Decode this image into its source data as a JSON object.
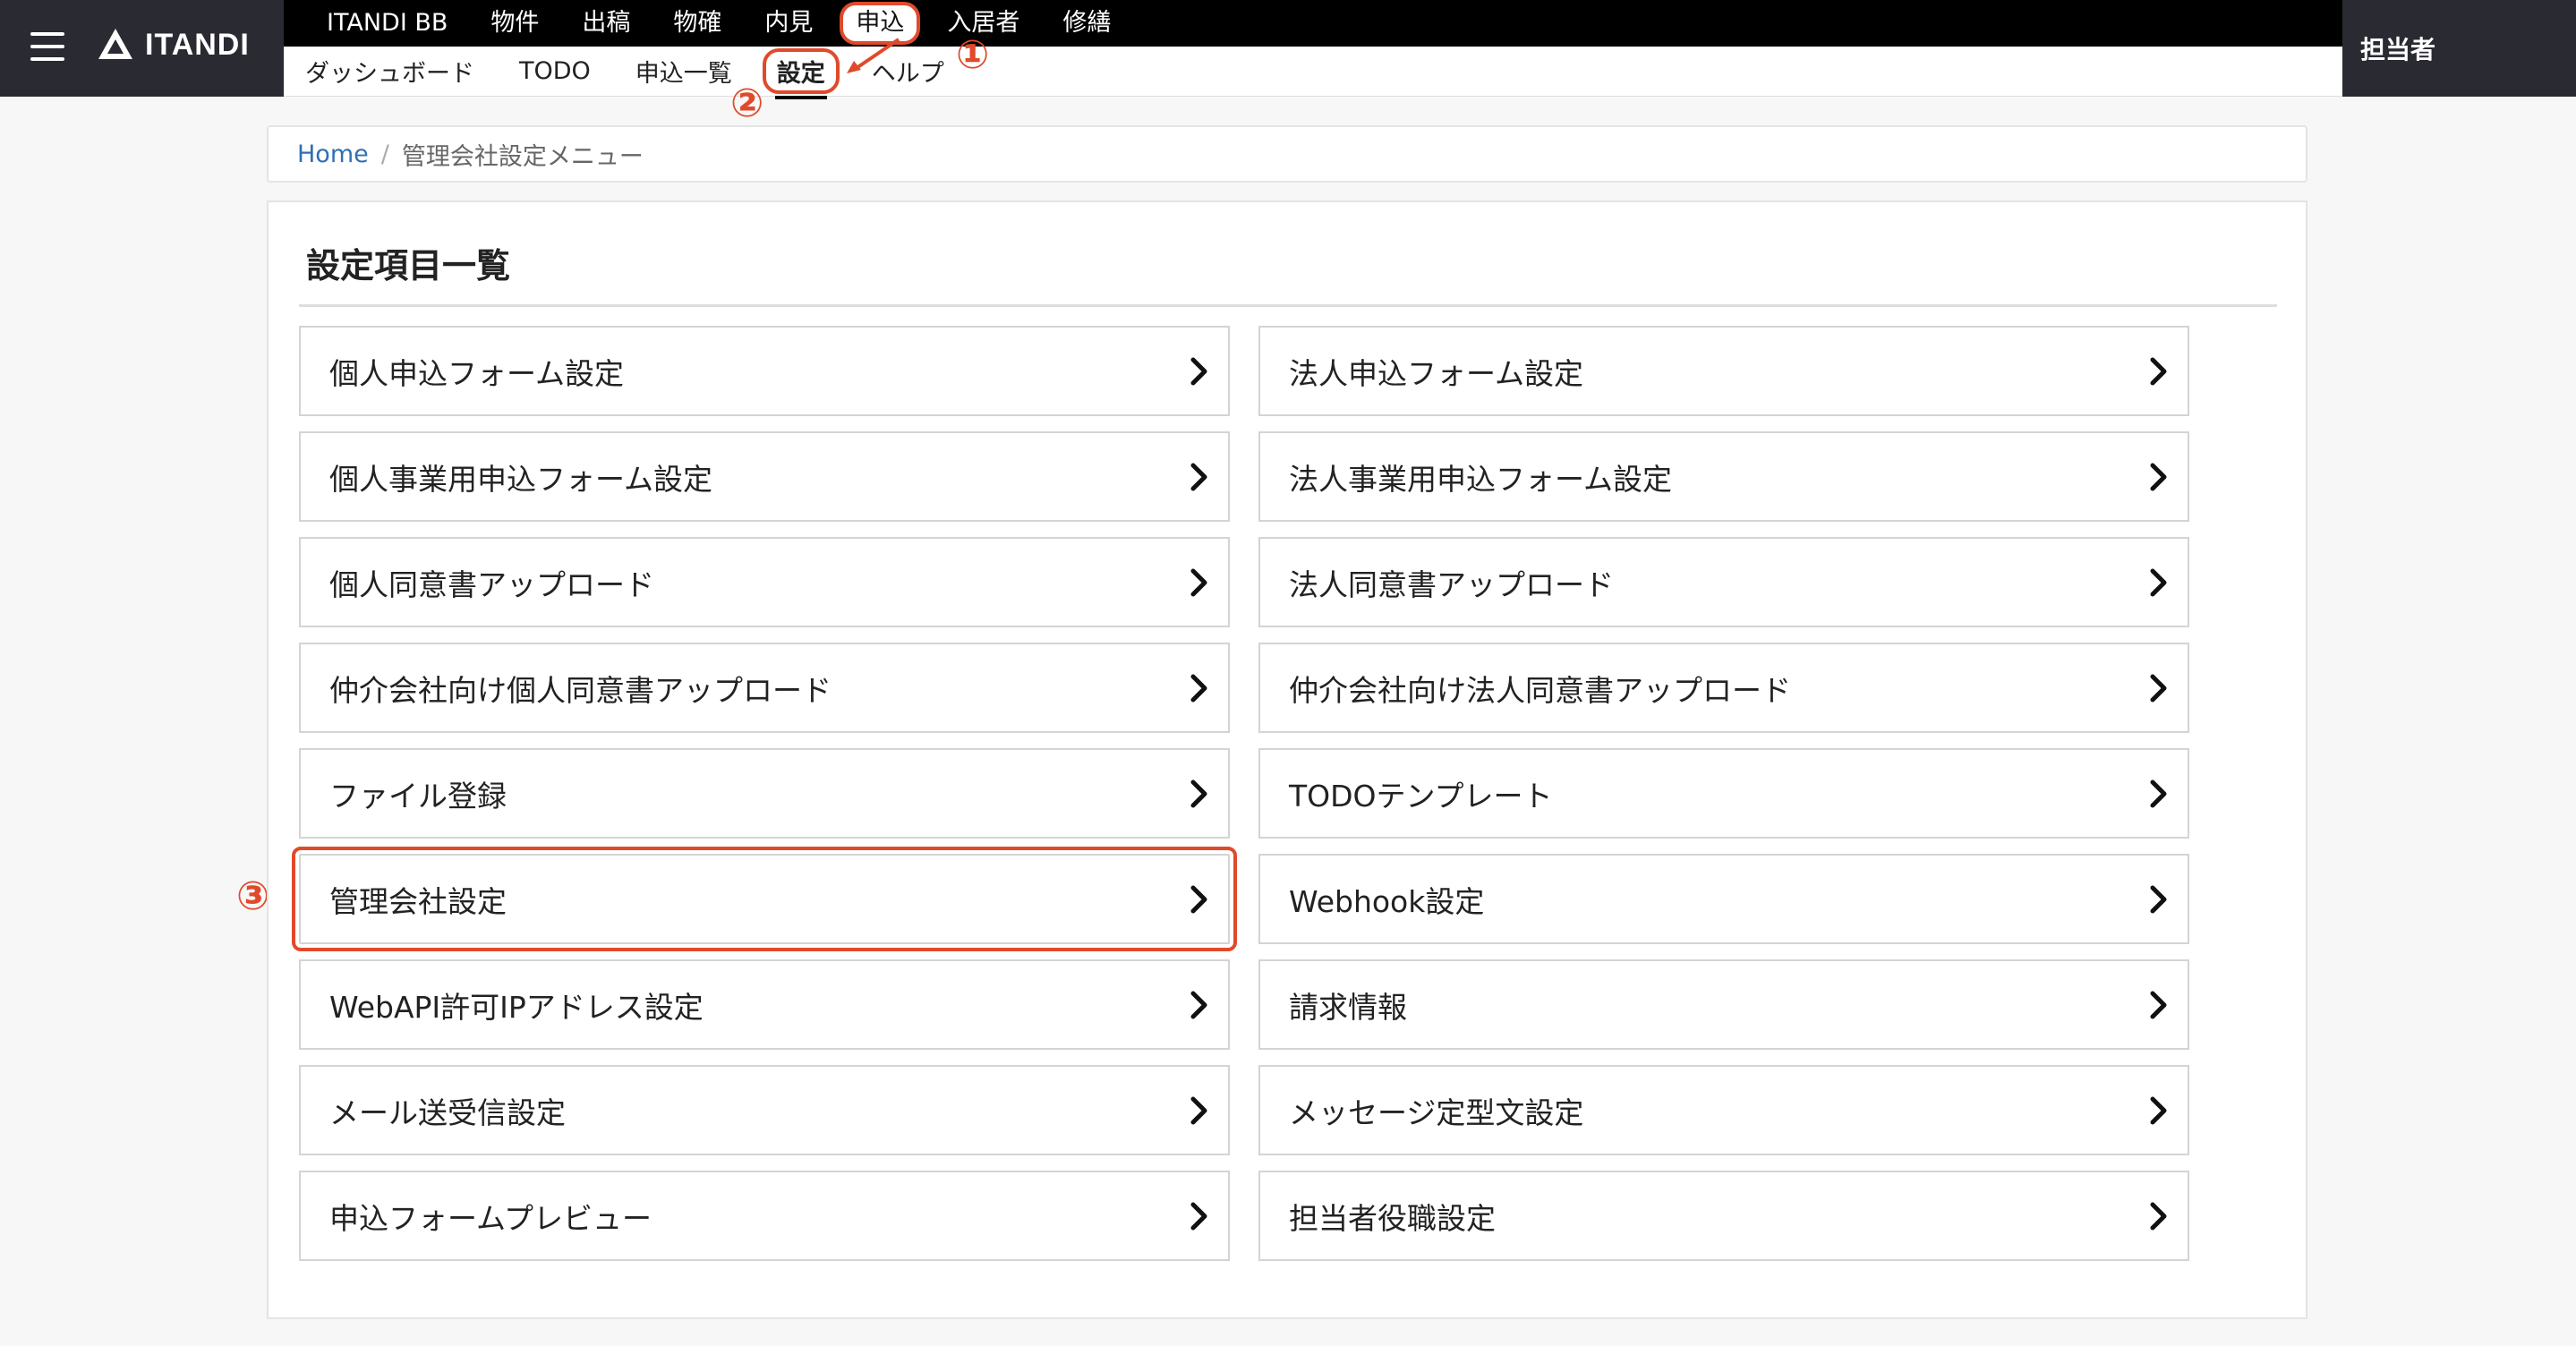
{
  "brand": {
    "logo_text": "ITANDI",
    "logo_icon": "itandi-logo-icon",
    "menu_icon": "hamburger-menu-icon"
  },
  "main_nav": {
    "items": [
      {
        "label": "ITANDI BB"
      },
      {
        "label": "物件"
      },
      {
        "label": "出稿"
      },
      {
        "label": "物確"
      },
      {
        "label": "内見"
      },
      {
        "label": "申込",
        "active": true
      },
      {
        "label": "入居者"
      },
      {
        "label": "修繕"
      }
    ]
  },
  "sub_nav": {
    "items": [
      {
        "label": "ダッシュボード"
      },
      {
        "label": "TODO"
      },
      {
        "label": "申込一覧"
      },
      {
        "label": "設定",
        "active": true
      },
      {
        "label": "ヘルプ"
      }
    ]
  },
  "user": {
    "label": "担当者"
  },
  "annotations": {
    "step1": "①",
    "step2": "②",
    "step3": "③",
    "color": "#e04a2a"
  },
  "breadcrumb": {
    "home": "Home",
    "separator": "/",
    "current": "管理会社設定メニュー"
  },
  "panel": {
    "title": "設定項目一覧",
    "items": [
      {
        "label": "個人申込フォーム設定"
      },
      {
        "label": "法人申込フォーム設定"
      },
      {
        "label": "個人事業用申込フォーム設定"
      },
      {
        "label": "法人事業用申込フォーム設定"
      },
      {
        "label": "個人同意書アップロード"
      },
      {
        "label": "法人同意書アップロード"
      },
      {
        "label": "仲介会社向け個人同意書アップロード"
      },
      {
        "label": "仲介会社向け法人同意書アップロード"
      },
      {
        "label": "ファイル登録"
      },
      {
        "label": "TODOテンプレート"
      },
      {
        "label": "管理会社設定",
        "highlighted": true
      },
      {
        "label": "Webhook設定"
      },
      {
        "label": "WebAPI許可IPアドレス設定"
      },
      {
        "label": "請求情報"
      },
      {
        "label": "メール送受信設定"
      },
      {
        "label": "メッセージ定型文設定"
      },
      {
        "label": "申込フォームプレビュー"
      },
      {
        "label": "担当者役職設定"
      }
    ],
    "item_icon": "chevron-right-icon"
  },
  "colors": {
    "nav_dark": "#2a2a33",
    "nav_black": "#000000",
    "highlight": "#e04a2a",
    "link": "#2f6fb5"
  }
}
